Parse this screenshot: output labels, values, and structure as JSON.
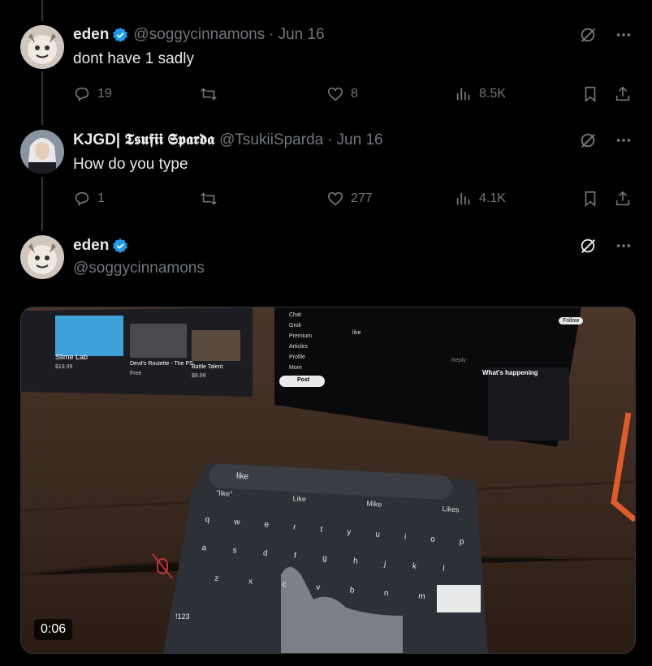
{
  "tweets": [
    {
      "name": "eden",
      "handle": "@soggycinnamons",
      "separator": "·",
      "date": "Jun 16",
      "text": "dont have 1 sadly",
      "replies": "19",
      "reposts": "",
      "likes": "8",
      "views": "8.5K"
    },
    {
      "name": "KJGD| 𝕿𝖘𝖚𝖋𝖎𝖎 𝕾𝖕𝖆𝖗𝖉𝖆",
      "handle": "@TsukiiSparda",
      "separator": "·",
      "date": "Jun 16",
      "text": "How do you type",
      "replies": "1",
      "reposts": "",
      "likes": "277",
      "views": "4.1K"
    }
  ],
  "main_tweet": {
    "name": "eden",
    "handle": "@soggycinnamons"
  },
  "video": {
    "timestamp": "0:06",
    "keyboard_input": "like",
    "suggestions": [
      "\"like\"",
      "Like",
      "Mike",
      "Likes"
    ],
    "keys_row1": [
      "q",
      "w",
      "e",
      "r",
      "t",
      "y",
      "u",
      "i",
      "o",
      "p"
    ],
    "keys_row2": [
      "a",
      "s",
      "d",
      "f",
      "g",
      "h",
      "j",
      "k",
      "l"
    ],
    "keys_row3": [
      "z",
      "x",
      "c",
      "v",
      "b",
      "n",
      "m"
    ],
    "key_numbers": "!123",
    "store_items": [
      "Slime Lab",
      "Devil's Roulette - The PS…",
      "Battle Talent"
    ],
    "store_prices": [
      "$19.99",
      "Free",
      "$9.99"
    ],
    "nav_items": [
      "Chat",
      "Grok",
      "Premium",
      "Articles",
      "Profile",
      "More"
    ],
    "post_button": "Post",
    "whats_happening": "What's happening",
    "follow_button": "Follow",
    "compose_text": "like",
    "reply_button": "Reply"
  },
  "colors": {
    "background": "#000000",
    "text": "#e7e9ea",
    "muted": "#71767b",
    "verified": "#1d9bf0",
    "border": "#2f3336"
  }
}
